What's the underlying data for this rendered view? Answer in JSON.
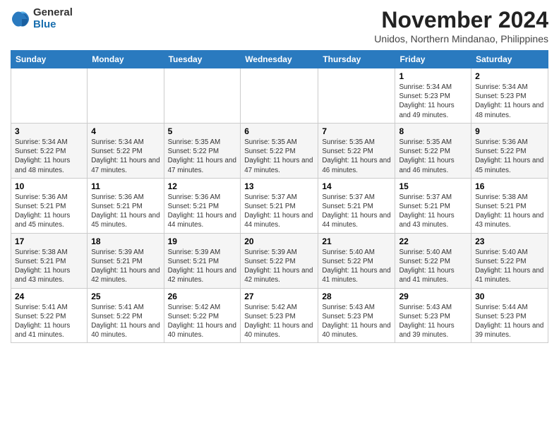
{
  "logo": {
    "general": "General",
    "blue": "Blue"
  },
  "title": "November 2024",
  "location": "Unidos, Northern Mindanao, Philippines",
  "headers": [
    "Sunday",
    "Monday",
    "Tuesday",
    "Wednesday",
    "Thursday",
    "Friday",
    "Saturday"
  ],
  "weeks": [
    [
      {
        "day": "",
        "info": ""
      },
      {
        "day": "",
        "info": ""
      },
      {
        "day": "",
        "info": ""
      },
      {
        "day": "",
        "info": ""
      },
      {
        "day": "",
        "info": ""
      },
      {
        "day": "1",
        "info": "Sunrise: 5:34 AM\nSunset: 5:23 PM\nDaylight: 11 hours and 49 minutes."
      },
      {
        "day": "2",
        "info": "Sunrise: 5:34 AM\nSunset: 5:23 PM\nDaylight: 11 hours and 48 minutes."
      }
    ],
    [
      {
        "day": "3",
        "info": "Sunrise: 5:34 AM\nSunset: 5:22 PM\nDaylight: 11 hours and 48 minutes."
      },
      {
        "day": "4",
        "info": "Sunrise: 5:34 AM\nSunset: 5:22 PM\nDaylight: 11 hours and 47 minutes."
      },
      {
        "day": "5",
        "info": "Sunrise: 5:35 AM\nSunset: 5:22 PM\nDaylight: 11 hours and 47 minutes."
      },
      {
        "day": "6",
        "info": "Sunrise: 5:35 AM\nSunset: 5:22 PM\nDaylight: 11 hours and 47 minutes."
      },
      {
        "day": "7",
        "info": "Sunrise: 5:35 AM\nSunset: 5:22 PM\nDaylight: 11 hours and 46 minutes."
      },
      {
        "day": "8",
        "info": "Sunrise: 5:35 AM\nSunset: 5:22 PM\nDaylight: 11 hours and 46 minutes."
      },
      {
        "day": "9",
        "info": "Sunrise: 5:36 AM\nSunset: 5:22 PM\nDaylight: 11 hours and 45 minutes."
      }
    ],
    [
      {
        "day": "10",
        "info": "Sunrise: 5:36 AM\nSunset: 5:21 PM\nDaylight: 11 hours and 45 minutes."
      },
      {
        "day": "11",
        "info": "Sunrise: 5:36 AM\nSunset: 5:21 PM\nDaylight: 11 hours and 45 minutes."
      },
      {
        "day": "12",
        "info": "Sunrise: 5:36 AM\nSunset: 5:21 PM\nDaylight: 11 hours and 44 minutes."
      },
      {
        "day": "13",
        "info": "Sunrise: 5:37 AM\nSunset: 5:21 PM\nDaylight: 11 hours and 44 minutes."
      },
      {
        "day": "14",
        "info": "Sunrise: 5:37 AM\nSunset: 5:21 PM\nDaylight: 11 hours and 44 minutes."
      },
      {
        "day": "15",
        "info": "Sunrise: 5:37 AM\nSunset: 5:21 PM\nDaylight: 11 hours and 43 minutes."
      },
      {
        "day": "16",
        "info": "Sunrise: 5:38 AM\nSunset: 5:21 PM\nDaylight: 11 hours and 43 minutes."
      }
    ],
    [
      {
        "day": "17",
        "info": "Sunrise: 5:38 AM\nSunset: 5:21 PM\nDaylight: 11 hours and 43 minutes."
      },
      {
        "day": "18",
        "info": "Sunrise: 5:39 AM\nSunset: 5:21 PM\nDaylight: 11 hours and 42 minutes."
      },
      {
        "day": "19",
        "info": "Sunrise: 5:39 AM\nSunset: 5:21 PM\nDaylight: 11 hours and 42 minutes."
      },
      {
        "day": "20",
        "info": "Sunrise: 5:39 AM\nSunset: 5:22 PM\nDaylight: 11 hours and 42 minutes."
      },
      {
        "day": "21",
        "info": "Sunrise: 5:40 AM\nSunset: 5:22 PM\nDaylight: 11 hours and 41 minutes."
      },
      {
        "day": "22",
        "info": "Sunrise: 5:40 AM\nSunset: 5:22 PM\nDaylight: 11 hours and 41 minutes."
      },
      {
        "day": "23",
        "info": "Sunrise: 5:40 AM\nSunset: 5:22 PM\nDaylight: 11 hours and 41 minutes."
      }
    ],
    [
      {
        "day": "24",
        "info": "Sunrise: 5:41 AM\nSunset: 5:22 PM\nDaylight: 11 hours and 41 minutes."
      },
      {
        "day": "25",
        "info": "Sunrise: 5:41 AM\nSunset: 5:22 PM\nDaylight: 11 hours and 40 minutes."
      },
      {
        "day": "26",
        "info": "Sunrise: 5:42 AM\nSunset: 5:22 PM\nDaylight: 11 hours and 40 minutes."
      },
      {
        "day": "27",
        "info": "Sunrise: 5:42 AM\nSunset: 5:23 PM\nDaylight: 11 hours and 40 minutes."
      },
      {
        "day": "28",
        "info": "Sunrise: 5:43 AM\nSunset: 5:23 PM\nDaylight: 11 hours and 40 minutes."
      },
      {
        "day": "29",
        "info": "Sunrise: 5:43 AM\nSunset: 5:23 PM\nDaylight: 11 hours and 39 minutes."
      },
      {
        "day": "30",
        "info": "Sunrise: 5:44 AM\nSunset: 5:23 PM\nDaylight: 11 hours and 39 minutes."
      }
    ]
  ]
}
